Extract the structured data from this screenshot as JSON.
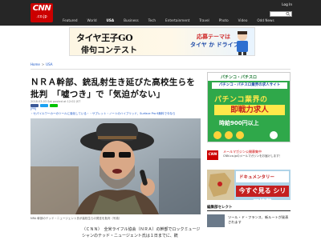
{
  "header": {
    "logo_text": "CNN",
    "logo_sub": ".co.jp",
    "login": "Log In",
    "nav": [
      {
        "label": "Featured",
        "active": false
      },
      {
        "label": "World",
        "active": false
      },
      {
        "label": "USA",
        "active": true
      },
      {
        "label": "Business",
        "active": false
      },
      {
        "label": "Tech",
        "active": false
      },
      {
        "label": "Entertainment",
        "active": false
      },
      {
        "label": "Travel",
        "active": false
      },
      {
        "label": "Photo",
        "active": false
      },
      {
        "label": "Video",
        "active": false
      },
      {
        "label": "Odd News",
        "active": false
      }
    ],
    "accent_color": "#cc0000",
    "bar_color": "#262626"
  },
  "banner": {
    "left_line1": "タイヤ王子GO",
    "left_line2": "俳句コンテスト",
    "right_line1": "応募テーマは",
    "right_line2": "タイヤ か ドライブ"
  },
  "breadcrumb": {
    "home": "Home",
    "separator": ">",
    "section": "USA"
  },
  "article": {
    "title": "ＮＲＡ幹部、銃乱射生き延びた高校生らを批判　「嘘つき」で「気迫がない」",
    "dateline": "2018.03.03 Sat posted at 12:02 JST",
    "pr_label": "[PR]",
    "pr_link": "・セパイルワーカーのツールに強化している・・サブレット・ノートのハイブリッド、Surface Pro 6無料で今なら",
    "caption": "NRA 幹部のテッド・ニュージェント氏が高校生らの発言を批判（写真）",
    "body_lead": "（ＣＮＮ）　全米ライフル協会（ＮＲＡ）の幹部でロックミュージシャンのテッド・ニュージェント氏は１日までに、銃"
  },
  "sidebar": {
    "ad1": {
      "brand": "パチンコ・パチスロ",
      "tagline": "パチンコ・パチスロ業界の求人サイト",
      "headline1": "パチンコ業界の",
      "headline2": "即戦力求人",
      "salary": "時給900円以上"
    },
    "cnn_promo": {
      "logo": "CNN",
      "title": "メールマガジン公開募集中",
      "subtitle": "CNN.co.jpのメールマガジンをお届けします！"
    },
    "ad2": {
      "line1": "ドキュメンタリー",
      "cta": "今すぐ見る シリア情勢"
    },
    "section_title": "編集部セレクト",
    "item_title": "ツール・ド・フランス、新ルートが発表されます"
  }
}
